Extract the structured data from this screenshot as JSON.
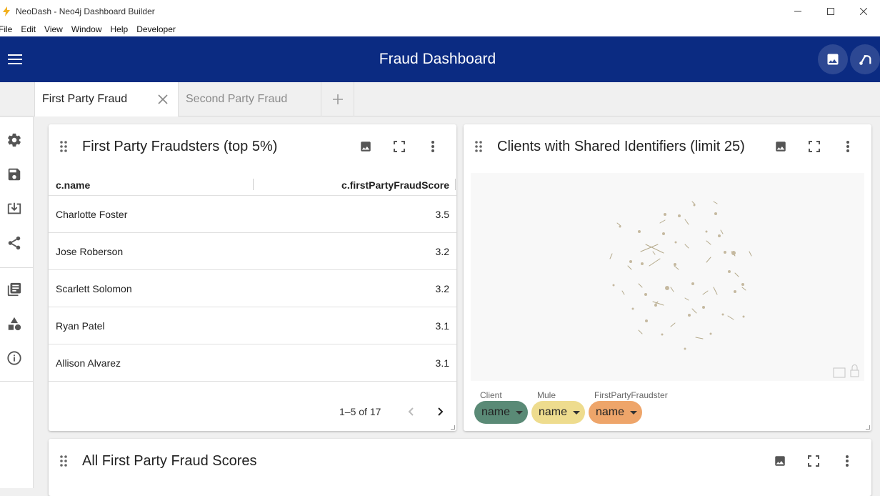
{
  "window": {
    "title": "NeoDash - Neo4j Dashboard Builder"
  },
  "menu": {
    "items": [
      "File",
      "Edit",
      "View",
      "Window",
      "Help",
      "Developer"
    ]
  },
  "header": {
    "title": "Fraud Dashboard",
    "bg_color": "#0b2b82"
  },
  "tabs": {
    "items": [
      {
        "label": "First Party Fraud",
        "active": true
      },
      {
        "label": "Second Party Fraud",
        "active": false
      }
    ]
  },
  "sidebar": {
    "icons": [
      "settings-icon",
      "save-icon",
      "load-icon",
      "share-icon",
      "examples-icon",
      "extensions-icon",
      "info-icon"
    ]
  },
  "cards": {
    "fraudsters": {
      "title": "First Party Fraudsters (top 5%)",
      "columns": [
        "c.name",
        "c.firstPartyFraudScore"
      ],
      "rows": [
        {
          "name": "Charlotte Foster",
          "score": "3.5"
        },
        {
          "name": "Jose Roberson",
          "score": "3.2"
        },
        {
          "name": "Scarlett Solomon",
          "score": "3.2"
        },
        {
          "name": "Ryan Patel",
          "score": "3.1"
        },
        {
          "name": "Allison Alvarez",
          "score": "3.1"
        }
      ],
      "pagination": "1–5 of 17"
    },
    "shared": {
      "title": "Clients with Shared Identifiers (limit 25)",
      "legend": [
        {
          "label": "Client",
          "value": "name",
          "color": "#5a8a76"
        },
        {
          "label": "Mule",
          "value": "name",
          "color": "#eedc8e"
        },
        {
          "label": "FirstPartyFraudster",
          "value": "name",
          "color": "#eea56a"
        }
      ]
    },
    "scores": {
      "title": "All First Party Fraud Scores"
    }
  }
}
